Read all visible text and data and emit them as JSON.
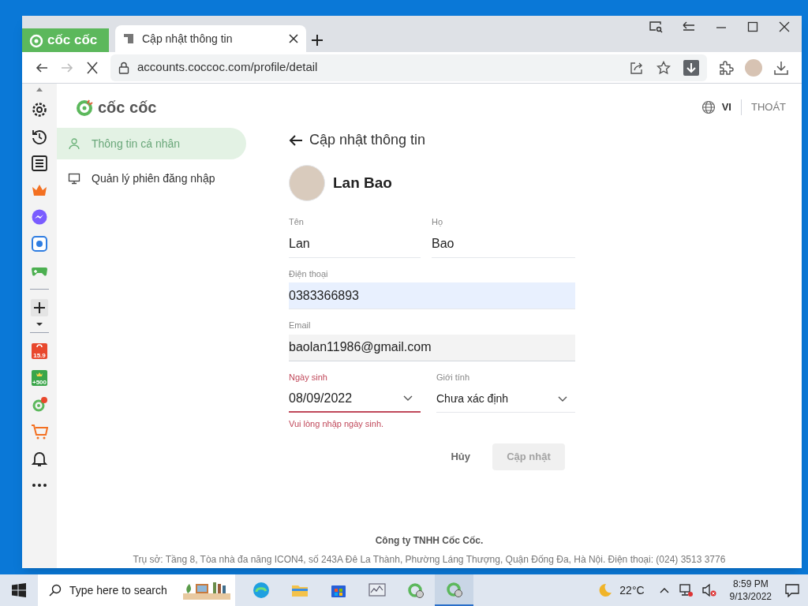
{
  "browser": {
    "brand": "cốc cốc",
    "tabs": [
      {
        "title": "Cập nhật thông tin",
        "selected": true
      }
    ],
    "address": "accounts.coccoc.com/profile/detail",
    "loading": true
  },
  "sidebar_icons": [
    {
      "kind": "settings"
    },
    {
      "kind": "history"
    },
    {
      "kind": "list"
    },
    {
      "kind": "crown"
    },
    {
      "kind": "messenger"
    },
    {
      "kind": "zalo"
    },
    {
      "kind": "gamepad"
    },
    {
      "kind": "divider"
    },
    {
      "kind": "add"
    },
    {
      "kind": "caret"
    },
    {
      "kind": "divider"
    },
    {
      "kind": "shop",
      "label": "15.9"
    },
    {
      "kind": "coins",
      "label": "+500"
    },
    {
      "kind": "coccoc"
    },
    {
      "kind": "cart"
    },
    {
      "kind": "bell"
    },
    {
      "kind": "more"
    }
  ],
  "page": {
    "logo": "cốc cốc",
    "language": "VI",
    "logout": "THOÁT",
    "nav": [
      {
        "label": "Thông tin cá nhân",
        "selected": true
      },
      {
        "label": "Quản lý phiên đăng nhập",
        "selected": false
      }
    ],
    "title": "Cập nhật thông tin",
    "name": "Lan Bao",
    "fields": [
      {
        "label": "Tên",
        "value": "Lan",
        "kind": "text",
        "autofilled": false,
        "readonly": false,
        "error": false
      },
      {
        "label": "Họ",
        "value": "Bao",
        "kind": "text",
        "autofilled": false,
        "readonly": false,
        "error": false
      },
      {
        "label": "Điện thoại",
        "value": "0383366893",
        "kind": "text",
        "autofilled": true,
        "readonly": false,
        "error": false
      },
      {
        "label": "Email",
        "value": "baolan11986@gmail.com",
        "kind": "text",
        "autofilled": false,
        "readonly": true,
        "error": false
      },
      {
        "label": "Ngày sinh",
        "value": "08/09/2022",
        "kind": "select",
        "autofilled": false,
        "readonly": false,
        "error": true
      },
      {
        "label": "Giới tính",
        "value": "Chưa xác định",
        "kind": "select",
        "autofilled": false,
        "readonly": false,
        "error": false
      }
    ],
    "error_message": "Vui lòng nhập ngày sinh.",
    "buttons": [
      {
        "label": "Hủy",
        "kind": "cancel",
        "disabled": false
      },
      {
        "label": "Cập nhật",
        "kind": "submit",
        "disabled": true
      }
    ],
    "footer": [
      "Công ty TNHH Cốc Cốc.",
      "Trụ sở: Tầng 8, Tòa nhà đa năng ICON4, số 243A Đê La Thành, Phường Láng Thượng, Quận Đống Đa, Hà Nội. Điện thoại: (024) 3513 3776"
    ]
  },
  "taskbar": {
    "search_placeholder": "Type here to search",
    "apps": [
      {
        "kind": "edge",
        "active": false
      },
      {
        "kind": "folder",
        "active": false
      },
      {
        "kind": "store",
        "active": false
      },
      {
        "kind": "monitor",
        "active": false
      },
      {
        "kind": "coccoc",
        "active": false
      },
      {
        "kind": "coccoc",
        "active": true
      }
    ],
    "temperature": "22°C",
    "time": "8:59 PM",
    "date": "9/13/2022"
  }
}
